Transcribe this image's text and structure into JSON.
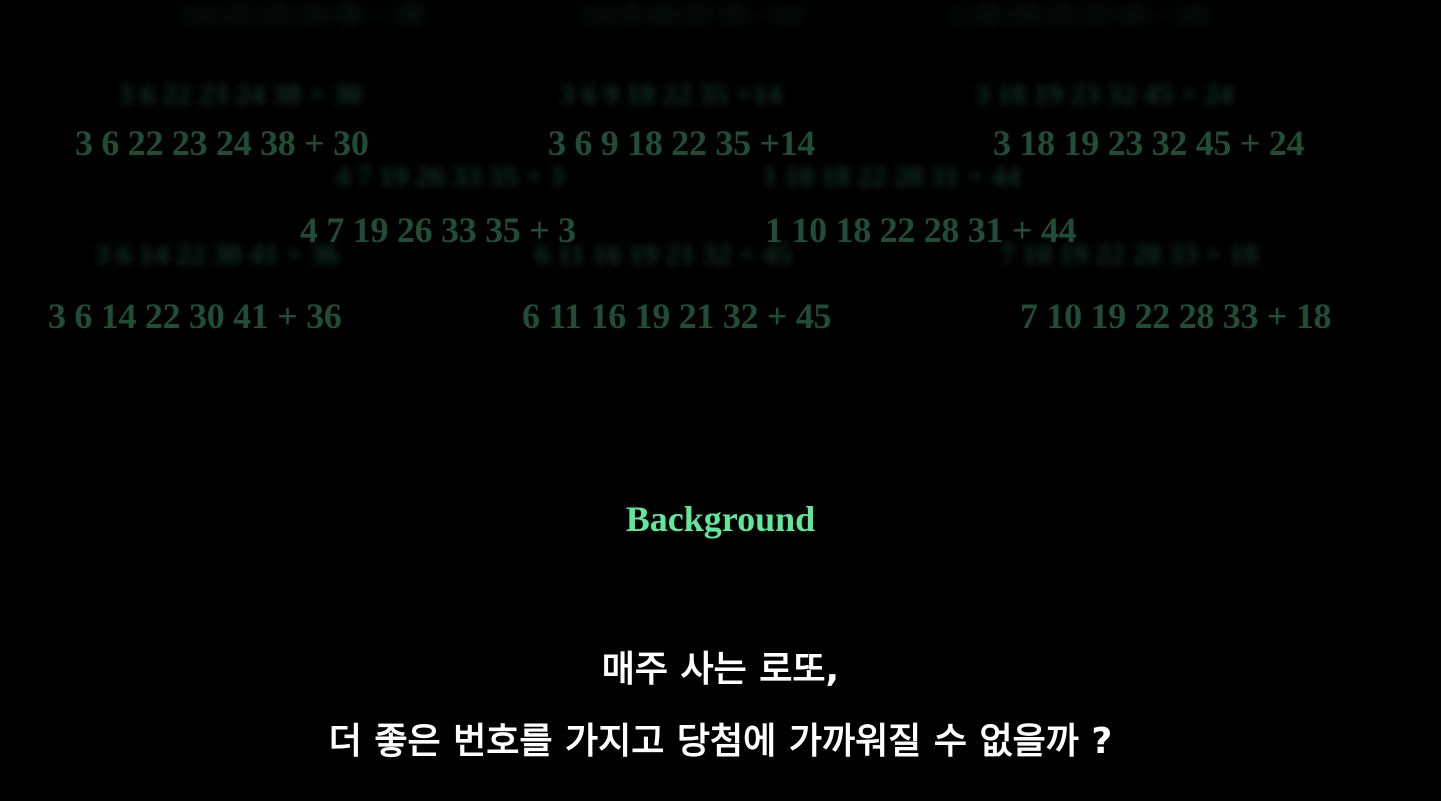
{
  "background": {
    "color": "#000000",
    "number_color": "#1f4d36"
  },
  "numbers": {
    "row1": [
      "3 6 22 23 24 38 + 30",
      "3 6 9 18 22 35 +14",
      "3 18 19 23 32 45 + 24"
    ],
    "row2": [
      "4  7 19 26 33 35 + 3",
      "1 10 18 22 28 31 + 44"
    ],
    "row3": [
      "3 6 14 22 30 41 + 36",
      "6 11 16 19 21 32 + 45",
      "7 10 19 22 28 33 + 18"
    ]
  },
  "heading": {
    "text": "Background",
    "color": "#5ee89a"
  },
  "caption": {
    "line1": "매주 사는 로또,",
    "line2": "더 좋은 번호를 가지고 당첨에 가까워질 수 없을까 ?",
    "color": "#ffffff"
  }
}
